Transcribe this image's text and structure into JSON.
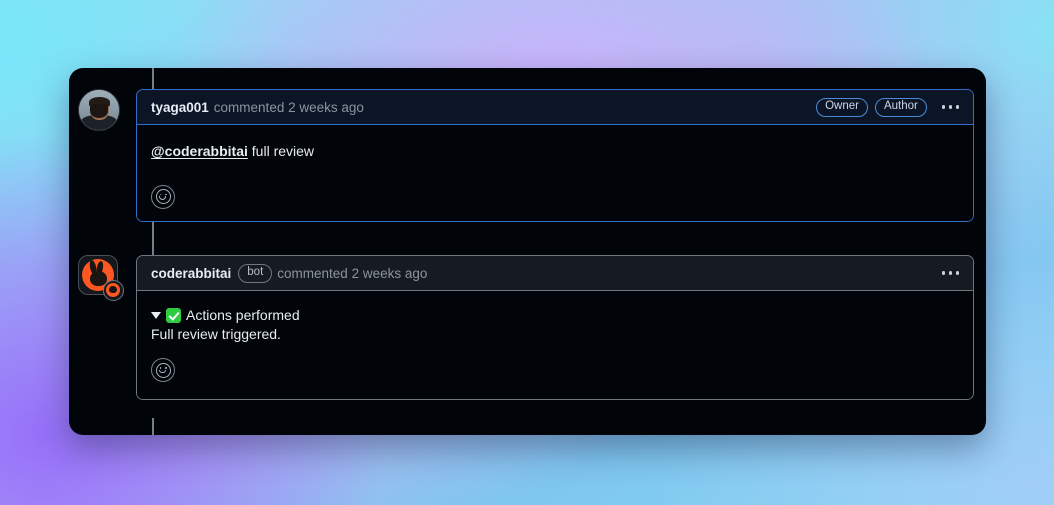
{
  "theme": {
    "panel_bg": "#010409",
    "header_bg_primary": "#0c1526",
    "header_bg_secondary": "#161b22",
    "border_blue": "#316dca",
    "border_gray": "#6e7681",
    "text_primary": "#e6edf3",
    "text_muted": "#8b949e",
    "accent_orange": "#ff5722",
    "accent_green": "#2ecc40",
    "wallpaper_cyan": "#8fe2f4",
    "wallpaper_purple": "#966efa"
  },
  "comments": [
    {
      "id": "comment-user",
      "avatar": {
        "name": "avatar-tyaga001",
        "type": "user-photo"
      },
      "author": "tyaga001",
      "action": "commented 2 weeks ago",
      "badges": [
        {
          "label": "Owner",
          "style": "blue"
        },
        {
          "label": "Author",
          "style": "blue"
        }
      ],
      "menu_label": "...",
      "border_style": "blue",
      "body": {
        "type": "mention",
        "mention": "@coderabbitai",
        "rest": " full review"
      },
      "reaction_label": "Add reaction"
    },
    {
      "id": "comment-bot",
      "avatar": {
        "name": "avatar-coderabbitai",
        "type": "bot-logo"
      },
      "author": "coderabbitai",
      "bot_badge": "bot",
      "action": "commented 2 weeks ago",
      "badges": [],
      "menu_label": "...",
      "border_style": "gray",
      "body": {
        "type": "details",
        "summary_icon": "white-check-mark",
        "summary": "Actions performed",
        "detail": "Full review triggered."
      },
      "reaction_label": "Add reaction"
    }
  ]
}
